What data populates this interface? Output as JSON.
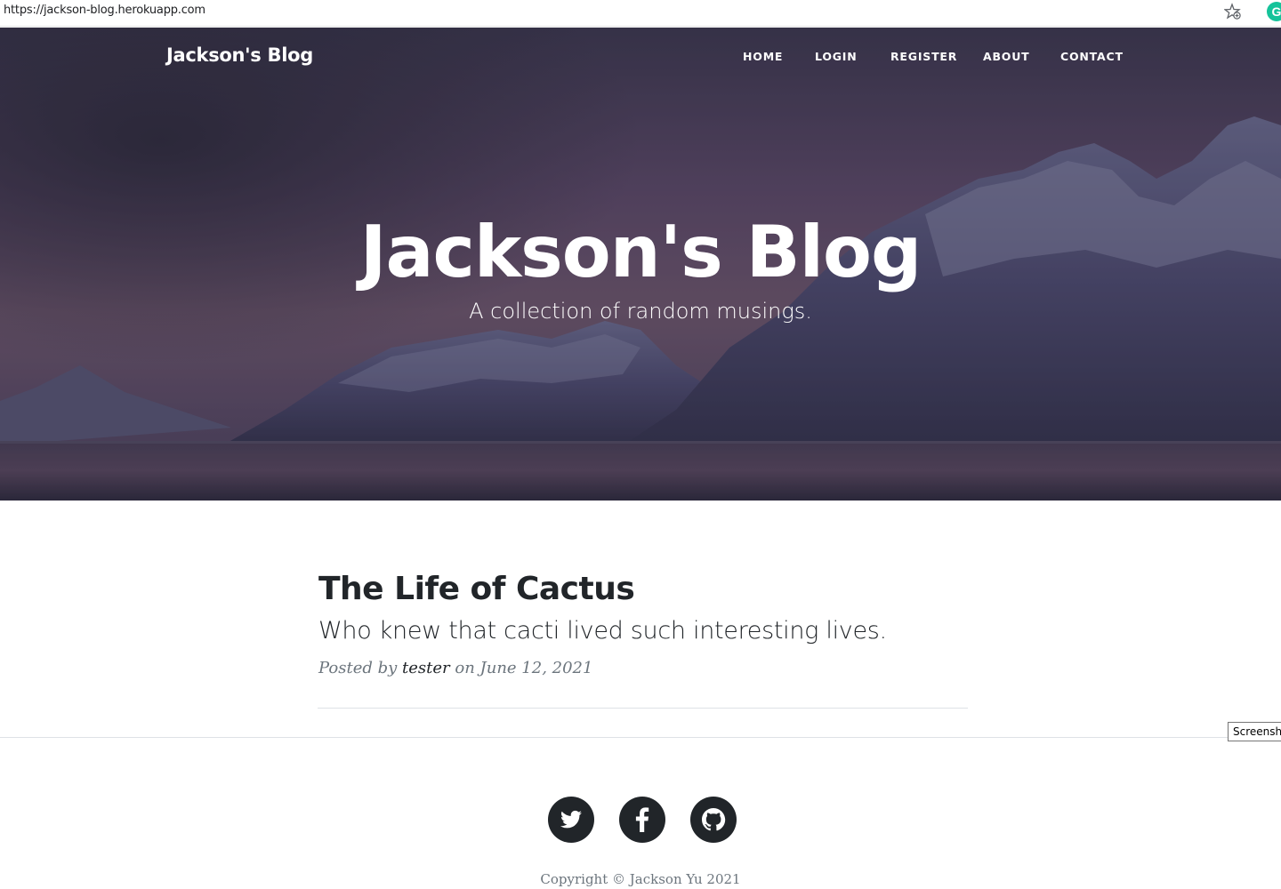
{
  "browser": {
    "url": "https://jackson-blog.herokuapp.com",
    "bookmark_icon": "star-add-icon",
    "extension_icon": "grammarly-icon",
    "extension_label": "G"
  },
  "nav": {
    "brand": "Jackson's Blog",
    "items": [
      {
        "label": "HOME"
      },
      {
        "label": "LOGIN"
      },
      {
        "label": "REGISTER"
      },
      {
        "label": "ABOUT"
      },
      {
        "label": "CONTACT"
      }
    ]
  },
  "hero": {
    "title": "Jackson's Blog",
    "subtitle": "A collection of random musings."
  },
  "post": {
    "title": "The Life of Cactus",
    "subtitle": "Who knew that cacti lived such interesting lives.",
    "meta_prefix": "Posted by",
    "author": "tester",
    "meta_suffix": "on June 12, 2021"
  },
  "tooltip": "Screenshot",
  "footer": {
    "social": [
      {
        "icon": "twitter-icon"
      },
      {
        "icon": "facebook-icon"
      },
      {
        "icon": "github-icon"
      }
    ],
    "copyright": "Copyright © Jackson Yu 2021"
  },
  "colors": {
    "accent_dark": "#212529",
    "muted": "#6c757d",
    "hero_tint": "#4a4060"
  }
}
